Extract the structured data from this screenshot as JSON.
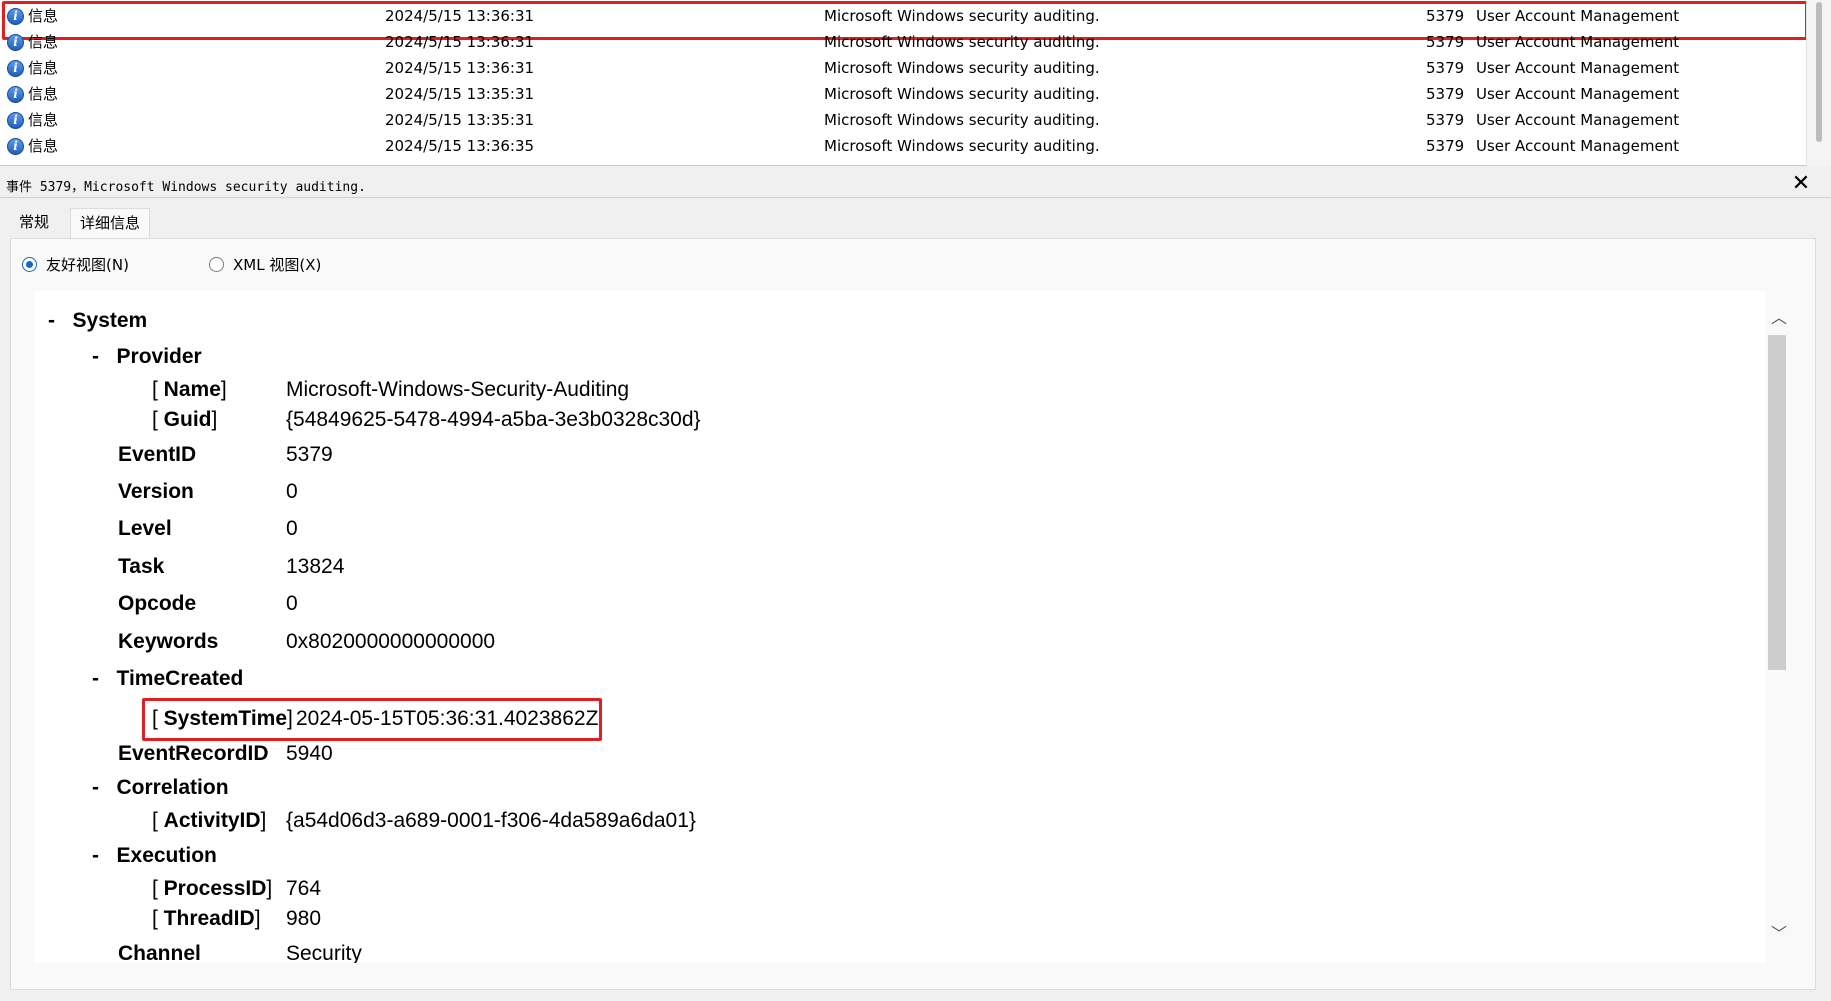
{
  "event_list": {
    "rows": [
      {
        "level": "信息",
        "date": "2024/5/15 13:36:31",
        "source": "Microsoft Windows security auditing.",
        "event_id": "5379",
        "category": "User Account Management"
      },
      {
        "level": "信息",
        "date": "2024/5/15 13:36:31",
        "source": "Microsoft Windows security auditing.",
        "event_id": "5379",
        "category": "User Account Management"
      },
      {
        "level": "信息",
        "date": "2024/5/15 13:36:31",
        "source": "Microsoft Windows security auditing.",
        "event_id": "5379",
        "category": "User Account Management"
      },
      {
        "level": "信息",
        "date": "2024/5/15 13:35:31",
        "source": "Microsoft Windows security auditing.",
        "event_id": "5379",
        "category": "User Account Management"
      },
      {
        "level": "信息",
        "date": "2024/5/15 13:35:31",
        "source": "Microsoft Windows security auditing.",
        "event_id": "5379",
        "category": "User Account Management"
      },
      {
        "level": "信息",
        "date": "2024/5/15 13:36:35",
        "source": "Microsoft Windows security auditing.",
        "event_id": "5379",
        "category": "User Account Management"
      }
    ]
  },
  "details": {
    "title": "事件 5379，Microsoft Windows security auditing.",
    "close_glyph": "✕",
    "tabs": {
      "general": "常规",
      "details": "详细信息"
    },
    "view_options": {
      "friendly": "友好视图(N)",
      "xml": "XML 视图(X)"
    },
    "tree": {
      "system": "System",
      "provider": "Provider",
      "provider_name_key": "Name",
      "provider_name": "Microsoft-Windows-Security-Auditing",
      "provider_guid_key": "Guid",
      "provider_guid": "{54849625-5478-4994-a5ba-3e3b0328c30d}",
      "eventid_key": "EventID",
      "eventid": "5379",
      "version_key": "Version",
      "version": "0",
      "level_key": "Level",
      "level": "0",
      "task_key": "Task",
      "task": "13824",
      "opcode_key": "Opcode",
      "opcode": "0",
      "keywords_key": "Keywords",
      "keywords": "0x8020000000000000",
      "timecreated": "TimeCreated",
      "systemtime_key": "SystemTime",
      "systemtime": "2024-05-15T05:36:31.4023862Z",
      "eventrecordid_key": "EventRecordID",
      "eventrecordid": "5940",
      "correlation": "Correlation",
      "activityid_key": "ActivityID",
      "activityid": "{a54d06d3-a689-0001-f306-4da589a6da01}",
      "execution": "Execution",
      "processid_key": "ProcessID",
      "processid": "764",
      "threadid_key": "ThreadID",
      "threadid": "980",
      "channel_key": "Channel",
      "channel": "Security"
    }
  },
  "colors": {
    "highlight": "#e02020",
    "radio_accent": "#1a66c4"
  }
}
